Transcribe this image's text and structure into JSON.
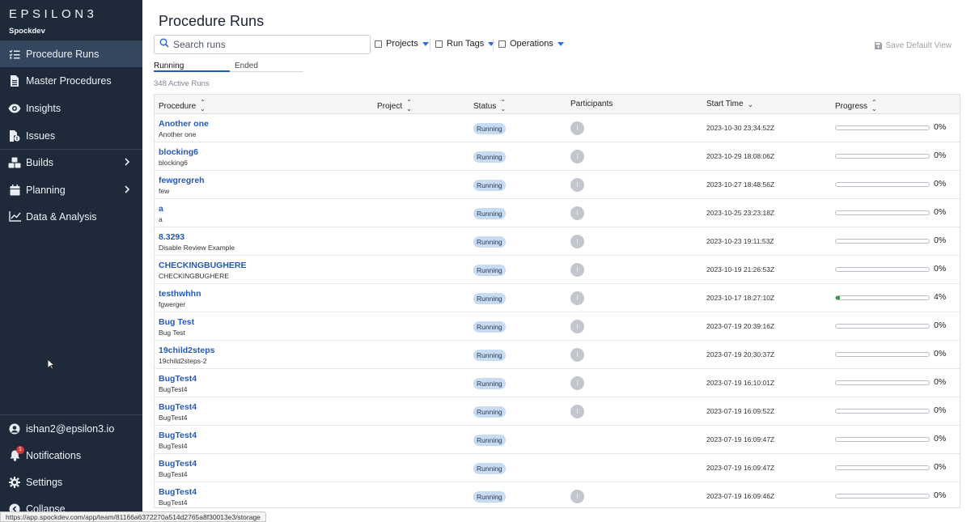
{
  "sidebar": {
    "logo": "EPSILON3",
    "team": "Spockdev",
    "nav": [
      {
        "label": "Procedure Runs",
        "icon": "list-check-icon",
        "active": true
      },
      {
        "label": "Master Procedures",
        "icon": "document-icon"
      },
      {
        "label": "Insights",
        "icon": "eye-icon"
      },
      {
        "label": "Issues",
        "icon": "issue-file-icon"
      },
      {
        "label": "Builds",
        "icon": "cubes-icon",
        "expandable": true
      },
      {
        "label": "Planning",
        "icon": "calendar-icon",
        "expandable": true
      },
      {
        "label": "Data & Analysis",
        "icon": "line-chart-icon"
      }
    ],
    "bottom": {
      "user": "ishan2@epsilon3.io",
      "notifications": "Notifications",
      "notification_count": "1",
      "settings": "Settings",
      "collapse": "Collapse"
    }
  },
  "header": {
    "title": "Procedure Runs",
    "search_placeholder": "Search runs",
    "filters": [
      "Projects",
      "Run Tags",
      "Operations"
    ],
    "save_default_view": "Save Default View"
  },
  "tabs": {
    "running": "Running",
    "ended": "Ended"
  },
  "active_runs": "348 Active Runs",
  "table": {
    "columns": {
      "procedure": "Procedure",
      "project": "Project",
      "status": "Status",
      "participants": "Participants",
      "start_time": "Start Time",
      "progress": "Progress"
    },
    "rows": [
      {
        "name": "Another one",
        "sub": "Another one",
        "status": "Running",
        "participant": "I",
        "start": "2023-10-30 23:34:52Z",
        "progress": "0%",
        "progress_value": 0
      },
      {
        "name": "blocking6",
        "sub": "blocking6",
        "status": "Running",
        "participant": "I",
        "start": "2023-10-29 18:08:06Z",
        "progress": "0%",
        "progress_value": 0
      },
      {
        "name": "fewgregreh",
        "sub": "few",
        "status": "Running",
        "participant": "I",
        "start": "2023-10-27 18:48:56Z",
        "progress": "0%",
        "progress_value": 0
      },
      {
        "name": "a",
        "sub": "a",
        "status": "Running",
        "participant": "I",
        "start": "2023-10-25 23:23:18Z",
        "progress": "0%",
        "progress_value": 0
      },
      {
        "name": "8.3293",
        "sub": "Disable Review Example",
        "status": "Running",
        "participant": "I",
        "start": "2023-10-23 19:11:53Z",
        "progress": "0%",
        "progress_value": 0
      },
      {
        "name": "CHECKINGBUGHERE",
        "sub": "CHECKINGBUGHERE",
        "status": "Running",
        "participant": "I",
        "start": "2023-10-19 21:26:53Z",
        "progress": "0%",
        "progress_value": 0
      },
      {
        "name": "testhwhhn",
        "sub": "fgwerger",
        "status": "Running",
        "participant": "I",
        "start": "2023-10-17 18:27:10Z",
        "progress": "4%",
        "progress_value": 4
      },
      {
        "name": "Bug Test",
        "sub": "Bug Test",
        "status": "Running",
        "participant": "I",
        "start": "2023-07-19 20:39:16Z",
        "progress": "0%",
        "progress_value": 0
      },
      {
        "name": "19child2steps",
        "sub": "19child2steps-2",
        "status": "Running",
        "participant": "I",
        "start": "2023-07-19 20:30:37Z",
        "progress": "0%",
        "progress_value": 0
      },
      {
        "name": "BugTest4",
        "sub": "BugTest4",
        "status": "Running",
        "participant": "I",
        "start": "2023-07-19 16:10:01Z",
        "progress": "0%",
        "progress_value": 0
      },
      {
        "name": "BugTest4",
        "sub": "BugTest4",
        "status": "Running",
        "participant": "I",
        "start": "2023-07-19 16:09:52Z",
        "progress": "0%",
        "progress_value": 0
      },
      {
        "name": "BugTest4",
        "sub": "BugTest4",
        "status": "Running",
        "participant": "",
        "start": "2023-07-19 16:09:47Z",
        "progress": "0%",
        "progress_value": 0
      },
      {
        "name": "BugTest4",
        "sub": "BugTest4",
        "status": "Running",
        "participant": "",
        "start": "2023-07-19 16:09:47Z",
        "progress": "0%",
        "progress_value": 0
      },
      {
        "name": "BugTest4",
        "sub": "BugTest4",
        "status": "Running",
        "participant": "I",
        "start": "2023-07-19 16:09:46Z",
        "progress": "0%",
        "progress_value": 0
      }
    ]
  },
  "status_url": "https://app.spockdev.com/app/team/81166a6372270a514d2765a8f30013e3/storage",
  "colors": {
    "sidebar_bg": "#1e2a3a",
    "link": "#2559b5",
    "status_pill": "#c7dbf3",
    "progress_fill": "#2a9d3f"
  }
}
